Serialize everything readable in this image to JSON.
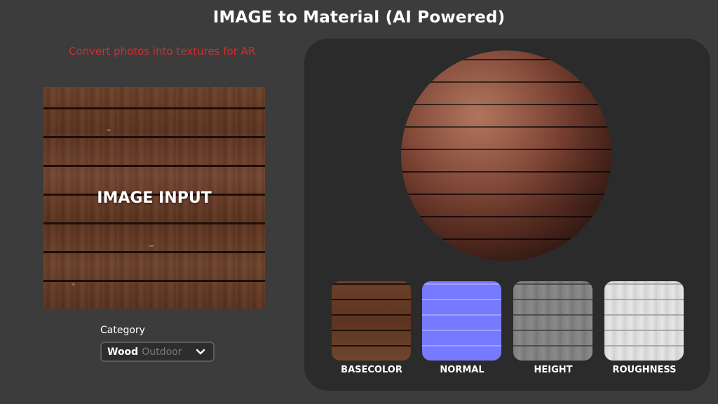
{
  "header": {
    "title": "IMAGE to Material (AI Powered)",
    "subtitle": "Convert photos into textures for AR"
  },
  "input": {
    "label": "IMAGE INPUT"
  },
  "category": {
    "label": "Category",
    "selected_main": "Wood",
    "selected_sub": "Outdoor"
  },
  "maps": [
    {
      "label": "BASECOLOR"
    },
    {
      "label": "NORMAL"
    },
    {
      "label": "HEIGHT"
    },
    {
      "label": "ROUGHNESS"
    }
  ],
  "colors": {
    "background": "#3c3c3c",
    "panel": "#2b2b2b",
    "subtitle": "#d92a2a",
    "normal_map": "#7a7cff"
  },
  "icons": {
    "dropdown": "chevron-down-icon"
  }
}
